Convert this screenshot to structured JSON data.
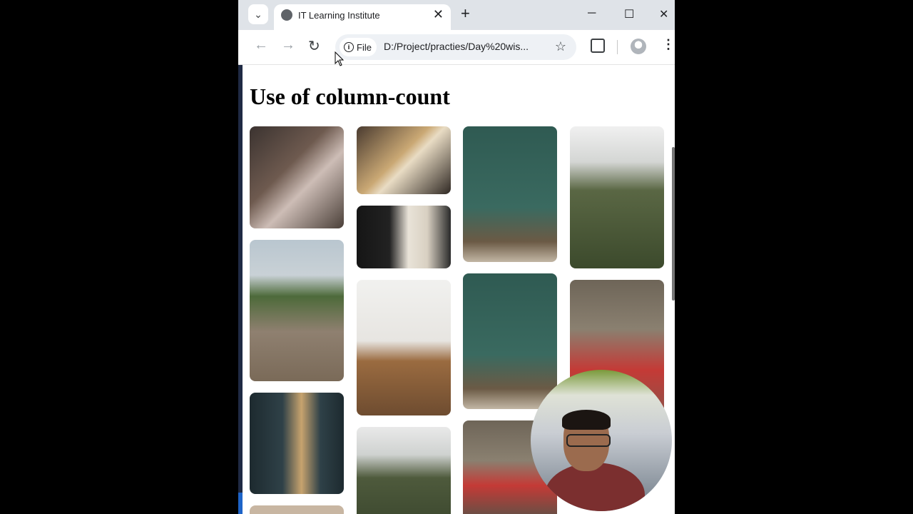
{
  "browser": {
    "tab_title": "IT Learning Institute",
    "tab_close_glyph": "✕",
    "new_tab_glyph": "+",
    "tab_search_glyph": "⌄",
    "minimize_glyph": "─",
    "maximize_glyph": "☐",
    "close_glyph": "✕",
    "back_glyph": "←",
    "forward_glyph": "→",
    "reload_glyph": "↻",
    "info_glyph": "i",
    "security_chip_label": "File",
    "url": "D:/Project/practies/Day%20wis...",
    "star_glyph": "☆",
    "menu_glyph": "⋮"
  },
  "page": {
    "heading": "Use of column-count"
  },
  "colors": {
    "tabbar_bg": "#dfe3e8",
    "omnibox_bg": "#eef1f5",
    "page_bg": "#ffffff"
  },
  "icons": [
    "tab-search-icon",
    "globe-icon",
    "close-icon",
    "plus-icon",
    "minimize-icon",
    "maximize-icon",
    "back-icon",
    "forward-icon",
    "reload-icon",
    "info-icon",
    "star-icon",
    "extensions-icon",
    "profile-icon",
    "kebab-menu-icon"
  ]
}
